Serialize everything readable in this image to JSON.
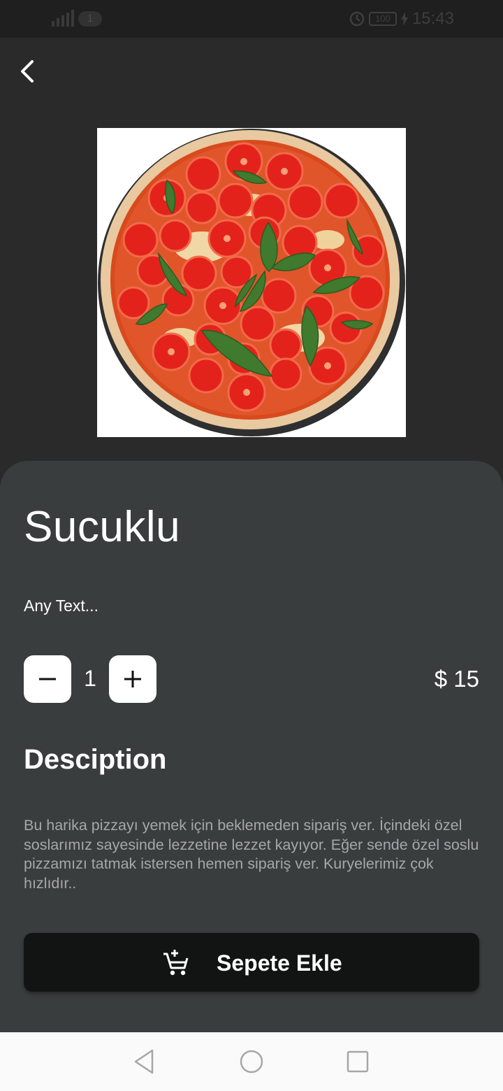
{
  "status_bar": {
    "sim_badge": "1",
    "battery": "100",
    "time": "15:43"
  },
  "product": {
    "name": "Sucuklu",
    "subtitle": "Any Text...",
    "quantity": "1",
    "price": "$ 15"
  },
  "description": {
    "heading": "Desciption",
    "text": "Bu harika pizzayı yemek için beklemeden sipariş ver. İçindeki özel soslarımız sayesinde lezzetine lezzet kayıyor. Eğer sende özel soslu pizzamızı tatmak istersen hemen sipariş ver. Kuryelerimiz çok hızlıdır.."
  },
  "actions": {
    "add_to_cart": "Sepete Ekle"
  },
  "icons": {
    "back": "chevron-left-icon",
    "minus": "minus-icon",
    "plus": "plus-icon",
    "cart": "add-shopping-cart-icon",
    "nav_back": "triangle-back-icon",
    "nav_home": "circle-home-icon",
    "nav_recents": "square-recents-icon"
  },
  "colors": {
    "background": "#2a2a2a",
    "panel": "#3a3d3e",
    "button_dark": "#121414",
    "text_primary": "#ffffff",
    "text_secondary": "#a5a8a9"
  }
}
